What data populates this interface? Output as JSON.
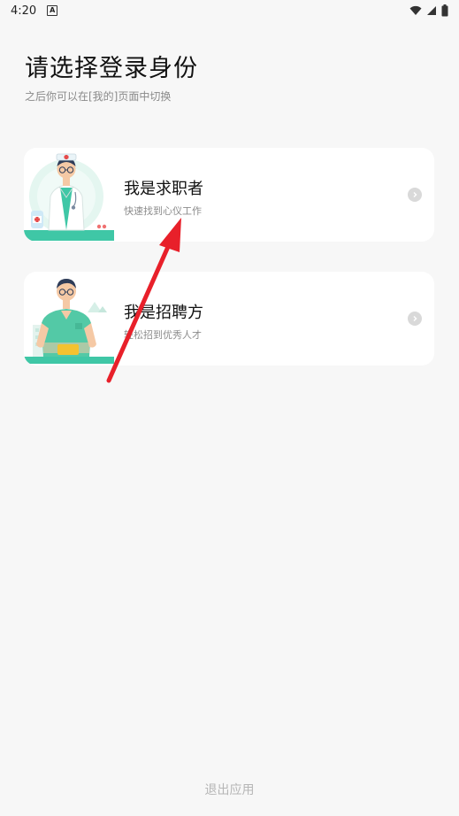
{
  "status_bar": {
    "time": "4:20",
    "notification_icon_letter": "A",
    "icons": [
      "wifi-icon",
      "signal-icon",
      "battery-icon"
    ]
  },
  "page": {
    "title": "请选择登录身份",
    "subtitle": "之后你可以在[我的]页面中切换"
  },
  "roles": [
    {
      "title": "我是求职者",
      "subtitle": "快速找到心仪工作",
      "illustration": "doctor-illustration",
      "icon": "chevron-right-icon"
    },
    {
      "title": "我是招聘方",
      "subtitle": "轻松招到优秀人才",
      "illustration": "recruiter-illustration",
      "icon": "chevron-right-icon"
    }
  ],
  "footer": {
    "exit_label": "退出应用"
  },
  "colors": {
    "accent": "#3fc7a6",
    "arrow": "#e8202a",
    "background": "#f7f7f7",
    "card": "#ffffff"
  }
}
